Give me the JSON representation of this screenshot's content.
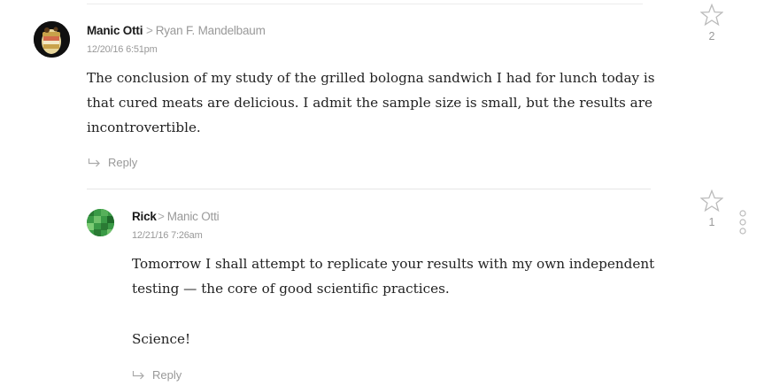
{
  "comments": [
    {
      "author": "Manic Otti",
      "reply_to": "Ryan F. Mandelbaum",
      "timestamp": "12/20/16 6:51pm",
      "paragraphs": [
        "The conclusion of my study of the grilled bologna sandwich I had for lunch today is",
        "that cured meats are delicious. I admit the sample size is small, but the results are",
        "incontrovertible."
      ],
      "reply_label": "Reply",
      "star_count": "2",
      "avatar_icon": "sandwich-avatar-icon"
    },
    {
      "author": "Rick",
      "reply_to": "Manic Otti",
      "timestamp": "12/21/16 7:26am",
      "paragraphs": [
        "Tomorrow I shall attempt to replicate your results with my own independent",
        "testing — the core of good scientific practices.",
        "Science!"
      ],
      "reply_label": "Reply",
      "star_count": "1",
      "avatar_icon": "pixel-avatar-icon"
    }
  ],
  "colors": {
    "text": "#222222",
    "muted": "#999999",
    "divider": "#e6e6e6",
    "avatar_green": "#2f8a3a"
  },
  "icons": [
    "star-icon",
    "reply-arrow-icon",
    "chevron-right-icon",
    "more-options-icon"
  ]
}
